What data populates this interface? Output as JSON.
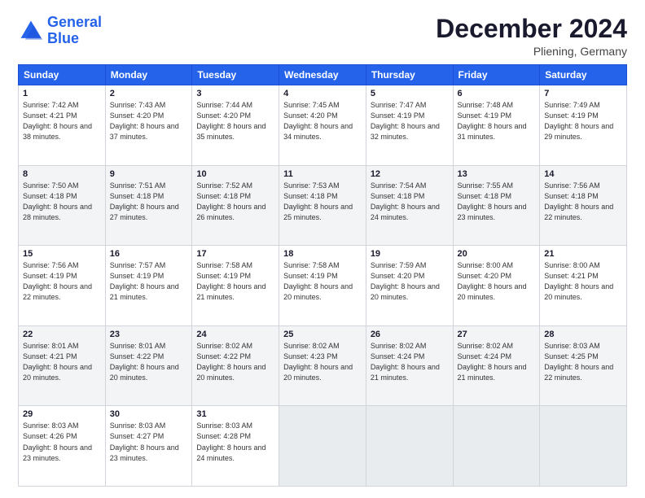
{
  "logo": {
    "line1": "General",
    "line2": "Blue"
  },
  "header": {
    "month_year": "December 2024",
    "location": "Pliening, Germany"
  },
  "weekdays": [
    "Sunday",
    "Monday",
    "Tuesday",
    "Wednesday",
    "Thursday",
    "Friday",
    "Saturday"
  ],
  "weeks": [
    [
      {
        "day": "1",
        "sunrise": "Sunrise: 7:42 AM",
        "sunset": "Sunset: 4:21 PM",
        "daylight": "Daylight: 8 hours and 38 minutes."
      },
      {
        "day": "2",
        "sunrise": "Sunrise: 7:43 AM",
        "sunset": "Sunset: 4:20 PM",
        "daylight": "Daylight: 8 hours and 37 minutes."
      },
      {
        "day": "3",
        "sunrise": "Sunrise: 7:44 AM",
        "sunset": "Sunset: 4:20 PM",
        "daylight": "Daylight: 8 hours and 35 minutes."
      },
      {
        "day": "4",
        "sunrise": "Sunrise: 7:45 AM",
        "sunset": "Sunset: 4:20 PM",
        "daylight": "Daylight: 8 hours and 34 minutes."
      },
      {
        "day": "5",
        "sunrise": "Sunrise: 7:47 AM",
        "sunset": "Sunset: 4:19 PM",
        "daylight": "Daylight: 8 hours and 32 minutes."
      },
      {
        "day": "6",
        "sunrise": "Sunrise: 7:48 AM",
        "sunset": "Sunset: 4:19 PM",
        "daylight": "Daylight: 8 hours and 31 minutes."
      },
      {
        "day": "7",
        "sunrise": "Sunrise: 7:49 AM",
        "sunset": "Sunset: 4:19 PM",
        "daylight": "Daylight: 8 hours and 29 minutes."
      }
    ],
    [
      {
        "day": "8",
        "sunrise": "Sunrise: 7:50 AM",
        "sunset": "Sunset: 4:18 PM",
        "daylight": "Daylight: 8 hours and 28 minutes."
      },
      {
        "day": "9",
        "sunrise": "Sunrise: 7:51 AM",
        "sunset": "Sunset: 4:18 PM",
        "daylight": "Daylight: 8 hours and 27 minutes."
      },
      {
        "day": "10",
        "sunrise": "Sunrise: 7:52 AM",
        "sunset": "Sunset: 4:18 PM",
        "daylight": "Daylight: 8 hours and 26 minutes."
      },
      {
        "day": "11",
        "sunrise": "Sunrise: 7:53 AM",
        "sunset": "Sunset: 4:18 PM",
        "daylight": "Daylight: 8 hours and 25 minutes."
      },
      {
        "day": "12",
        "sunrise": "Sunrise: 7:54 AM",
        "sunset": "Sunset: 4:18 PM",
        "daylight": "Daylight: 8 hours and 24 minutes."
      },
      {
        "day": "13",
        "sunrise": "Sunrise: 7:55 AM",
        "sunset": "Sunset: 4:18 PM",
        "daylight": "Daylight: 8 hours and 23 minutes."
      },
      {
        "day": "14",
        "sunrise": "Sunrise: 7:56 AM",
        "sunset": "Sunset: 4:18 PM",
        "daylight": "Daylight: 8 hours and 22 minutes."
      }
    ],
    [
      {
        "day": "15",
        "sunrise": "Sunrise: 7:56 AM",
        "sunset": "Sunset: 4:19 PM",
        "daylight": "Daylight: 8 hours and 22 minutes."
      },
      {
        "day": "16",
        "sunrise": "Sunrise: 7:57 AM",
        "sunset": "Sunset: 4:19 PM",
        "daylight": "Daylight: 8 hours and 21 minutes."
      },
      {
        "day": "17",
        "sunrise": "Sunrise: 7:58 AM",
        "sunset": "Sunset: 4:19 PM",
        "daylight": "Daylight: 8 hours and 21 minutes."
      },
      {
        "day": "18",
        "sunrise": "Sunrise: 7:58 AM",
        "sunset": "Sunset: 4:19 PM",
        "daylight": "Daylight: 8 hours and 20 minutes."
      },
      {
        "day": "19",
        "sunrise": "Sunrise: 7:59 AM",
        "sunset": "Sunset: 4:20 PM",
        "daylight": "Daylight: 8 hours and 20 minutes."
      },
      {
        "day": "20",
        "sunrise": "Sunrise: 8:00 AM",
        "sunset": "Sunset: 4:20 PM",
        "daylight": "Daylight: 8 hours and 20 minutes."
      },
      {
        "day": "21",
        "sunrise": "Sunrise: 8:00 AM",
        "sunset": "Sunset: 4:21 PM",
        "daylight": "Daylight: 8 hours and 20 minutes."
      }
    ],
    [
      {
        "day": "22",
        "sunrise": "Sunrise: 8:01 AM",
        "sunset": "Sunset: 4:21 PM",
        "daylight": "Daylight: 8 hours and 20 minutes."
      },
      {
        "day": "23",
        "sunrise": "Sunrise: 8:01 AM",
        "sunset": "Sunset: 4:22 PM",
        "daylight": "Daylight: 8 hours and 20 minutes."
      },
      {
        "day": "24",
        "sunrise": "Sunrise: 8:02 AM",
        "sunset": "Sunset: 4:22 PM",
        "daylight": "Daylight: 8 hours and 20 minutes."
      },
      {
        "day": "25",
        "sunrise": "Sunrise: 8:02 AM",
        "sunset": "Sunset: 4:23 PM",
        "daylight": "Daylight: 8 hours and 20 minutes."
      },
      {
        "day": "26",
        "sunrise": "Sunrise: 8:02 AM",
        "sunset": "Sunset: 4:24 PM",
        "daylight": "Daylight: 8 hours and 21 minutes."
      },
      {
        "day": "27",
        "sunrise": "Sunrise: 8:02 AM",
        "sunset": "Sunset: 4:24 PM",
        "daylight": "Daylight: 8 hours and 21 minutes."
      },
      {
        "day": "28",
        "sunrise": "Sunrise: 8:03 AM",
        "sunset": "Sunset: 4:25 PM",
        "daylight": "Daylight: 8 hours and 22 minutes."
      }
    ],
    [
      {
        "day": "29",
        "sunrise": "Sunrise: 8:03 AM",
        "sunset": "Sunset: 4:26 PM",
        "daylight": "Daylight: 8 hours and 23 minutes."
      },
      {
        "day": "30",
        "sunrise": "Sunrise: 8:03 AM",
        "sunset": "Sunset: 4:27 PM",
        "daylight": "Daylight: 8 hours and 23 minutes."
      },
      {
        "day": "31",
        "sunrise": "Sunrise: 8:03 AM",
        "sunset": "Sunset: 4:28 PM",
        "daylight": "Daylight: 8 hours and 24 minutes."
      },
      null,
      null,
      null,
      null
    ]
  ]
}
